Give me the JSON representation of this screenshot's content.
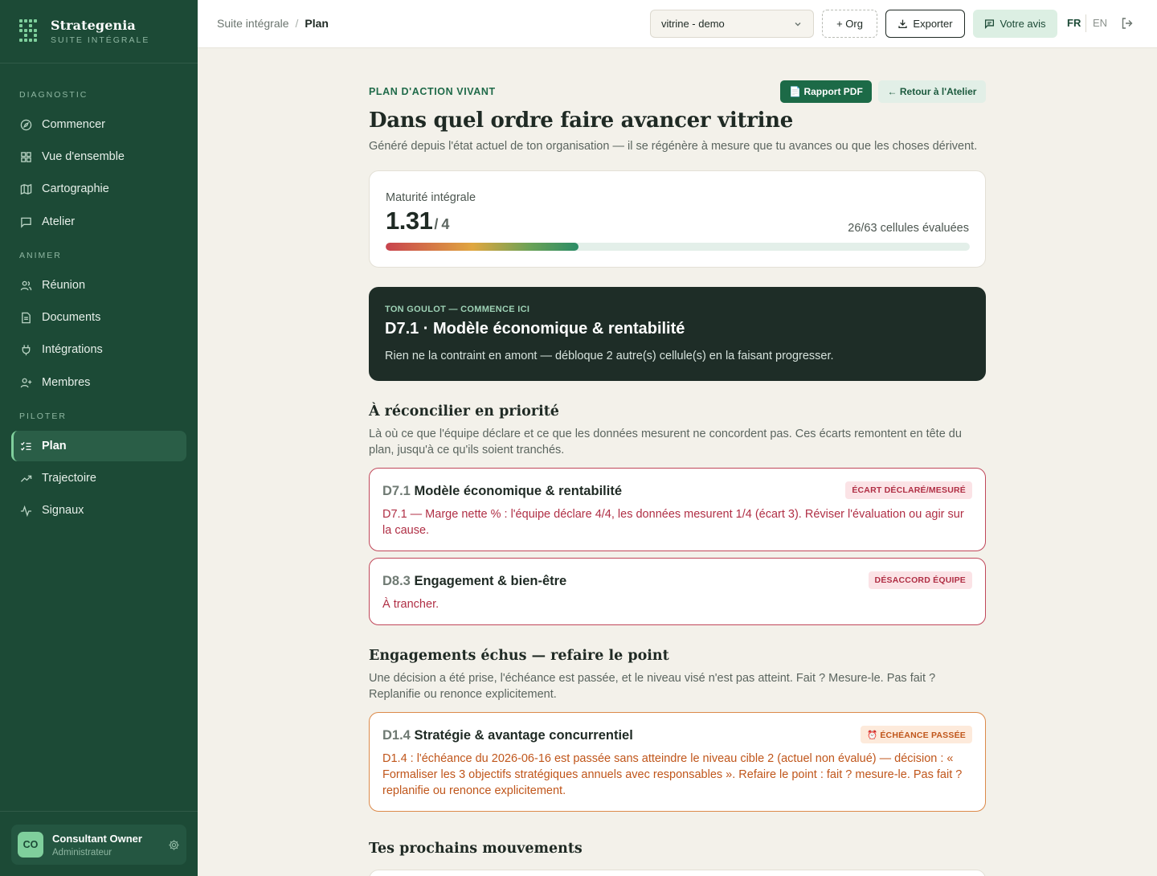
{
  "brand": {
    "name": "Strategenia",
    "subtitle": "SUITE INTÉGRALE"
  },
  "sidebar": {
    "sections": [
      {
        "label": "DIAGNOSTIC"
      },
      {
        "label": "ANIMER"
      },
      {
        "label": "PILOTER"
      }
    ],
    "items": [
      {
        "label": "Commencer",
        "icon": "compass-icon"
      },
      {
        "label": "Vue d'ensemble",
        "icon": "grid-icon"
      },
      {
        "label": "Cartographie",
        "icon": "map-icon"
      },
      {
        "label": "Atelier",
        "icon": "message-square-icon"
      },
      {
        "label": "Réunion",
        "icon": "users-icon"
      },
      {
        "label": "Documents",
        "icon": "file-icon"
      },
      {
        "label": "Intégrations",
        "icon": "plug-icon"
      },
      {
        "label": "Membres",
        "icon": "user-plus-icon"
      },
      {
        "label": "Plan",
        "icon": "list-checks-icon",
        "active": true
      },
      {
        "label": "Trajectoire",
        "icon": "trending-up-icon"
      },
      {
        "label": "Signaux",
        "icon": "activity-icon"
      }
    ],
    "user": {
      "initials": "CO",
      "name": "Consultant Owner",
      "role": "Administrateur"
    }
  },
  "topbar": {
    "breadcrumb": [
      "Suite intégrale",
      "Plan"
    ],
    "org_select": "vitrine - demo",
    "org_button": "+ Org",
    "export_button": "Exporter",
    "feedback_button": "Votre avis",
    "lang_fr": "FR",
    "lang_en": "EN"
  },
  "page": {
    "eyebrow": "PLAN D'ACTION VIVANT",
    "pdf_button": "📄 Rapport PDF",
    "back_button": "← Retour à l'Atelier",
    "title": "Dans quel ordre faire avancer vitrine",
    "subtitle": "Généré depuis l'état actuel de ton organisation — il se régénère à mesure que tu avances ou que les choses dérivent."
  },
  "maturity": {
    "label": "Maturité intégrale",
    "value": "1.31",
    "max": "/ 4",
    "cells": "26/63 cellules évaluées",
    "progress": 0.33
  },
  "goulot": {
    "eyebrow": "TON GOULOT — COMMENCE ICI",
    "title": "D7.1 · Modèle économique & rentabilité",
    "description": "Rien ne la contraint en amont — débloque 2 autre(s) cellule(s) en la faisant progresser."
  },
  "reconcile": {
    "title": "À réconcilier en priorité",
    "description": "Là où ce que l'équipe déclare et ce que les données mesurent ne concordent pas. Ces écarts remontent en tête du plan, jusqu'à ce qu'ils soient tranchés.",
    "cards": [
      {
        "code": "D7.1",
        "name": "Modèle économique & rentabilité",
        "badge": "ÉCART DÉCLARÉ/MESURÉ",
        "body": "D7.1 — Marge nette % : l'équipe déclare 4/4, les données mesurent 1/4 (écart 3). Réviser l'évaluation ou agir sur la cause."
      },
      {
        "code": "D8.3",
        "name": "Engagement & bien-être",
        "badge": "DÉSACCORD ÉQUIPE",
        "body": "À trancher."
      }
    ]
  },
  "overdue": {
    "title": "Engagements échus — refaire le point",
    "description": "Une décision a été prise, l'échéance est passée, et le niveau visé n'est pas atteint. Fait ? Mesure-le. Pas fait ? Replanifie ou renonce explicitement.",
    "cards": [
      {
        "code": "D1.4",
        "name": "Stratégie & avantage concurrentiel",
        "badge": "⏰ ÉCHÉANCE PASSÉE",
        "body": "D1.4 : l'échéance du 2026-06-16 est passée sans atteindre le niveau cible 2 (actuel non évalué) — décision : « Formaliser les 3 objectifs stratégiques annuels avec responsables ». Refaire le point : fait ? mesure-le. Pas fait ? replanifie ou renonce explicitement."
      }
    ]
  },
  "next": {
    "title": "Tes prochains mouvements"
  },
  "colors": {
    "sidebar": "#1c4a36",
    "accent": "#7fcf9c",
    "danger": "#b02f45",
    "warning": "#c0561b",
    "background": "#f3f1ea"
  }
}
